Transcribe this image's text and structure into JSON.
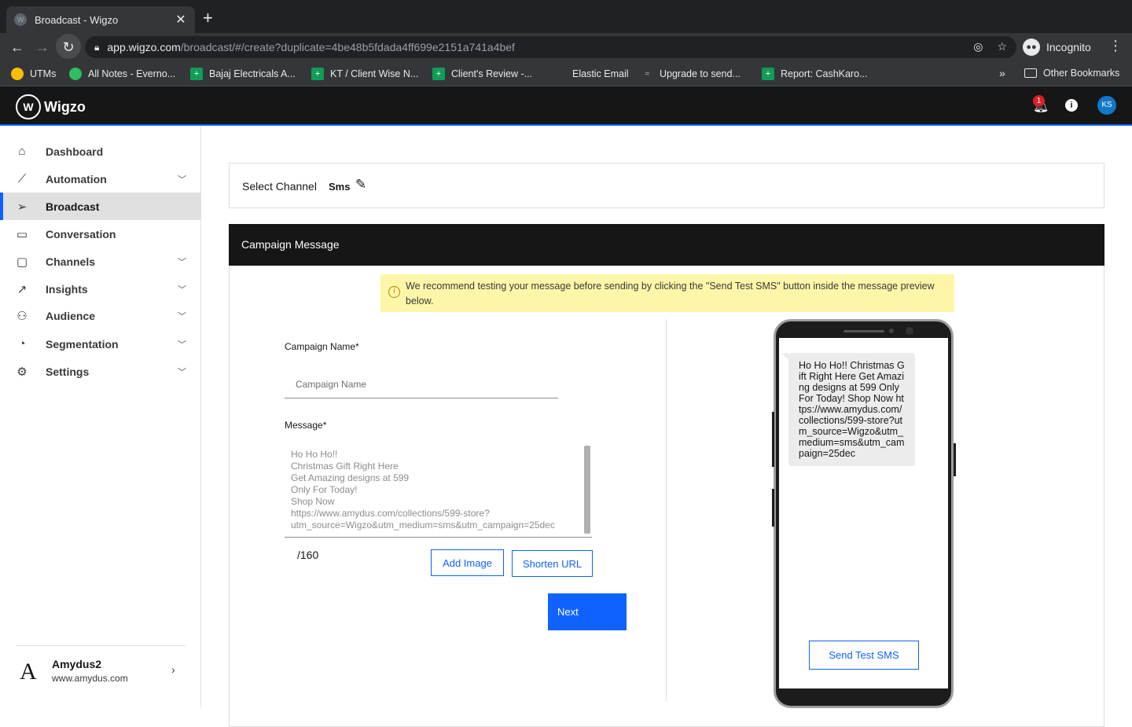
{
  "browser": {
    "tab_title": "Broadcast - Wigzo",
    "tab_favicon": "W",
    "url_host": "app.wigzo.com",
    "url_path": "/broadcast/#/create?duplicate=4be48b5fdada4ff699e2151a741a4bef",
    "profile_label": "Incognito",
    "bookmarks": [
      {
        "label": "UTMs",
        "icon": "chrome-icon",
        "color": "#fbbc04"
      },
      {
        "label": "All Notes - Everno...",
        "icon": "evernote-icon",
        "color": "#2dbe60"
      },
      {
        "label": "Bajaj Electricals A...",
        "icon": "sheets-icon",
        "color": "#0f9d58"
      },
      {
        "label": "KT / Client Wise N...",
        "icon": "sheets-icon",
        "color": "#0f9d58"
      },
      {
        "label": "Client's Review -...",
        "icon": "sheets-icon",
        "color": "#0f9d58"
      },
      {
        "label": "Elastic Email",
        "icon": "elastic-icon",
        "color": "#35363a"
      },
      {
        "label": "Upgrade to send...",
        "icon": "wigzo-icon",
        "color": "#35363a"
      },
      {
        "label": "Report: CashKaro...",
        "icon": "sheets-icon",
        "color": "#0f9d58"
      }
    ],
    "bookmarks_more": "»",
    "other_bookmarks": "Other Bookmarks"
  },
  "header": {
    "logo_mark": "W",
    "logo_text": "Wigzo",
    "notification_count": "1",
    "avatar_initials": "KS"
  },
  "sidebar": {
    "items": [
      {
        "label": "Dashboard",
        "icon": "home-icon",
        "has_chevron": false,
        "active": false
      },
      {
        "label": "Automation",
        "icon": "wand-icon",
        "has_chevron": true,
        "active": false
      },
      {
        "label": "Broadcast",
        "icon": "send-icon",
        "has_chevron": false,
        "active": true
      },
      {
        "label": "Conversation",
        "icon": "chat-icon",
        "has_chevron": false,
        "active": false
      },
      {
        "label": "Channels",
        "icon": "channels-icon",
        "has_chevron": true,
        "active": false
      },
      {
        "label": "Insights",
        "icon": "chart-icon",
        "has_chevron": true,
        "active": false
      },
      {
        "label": "Audience",
        "icon": "users-icon",
        "has_chevron": true,
        "active": false
      },
      {
        "label": "Segmentation",
        "icon": "pie-icon",
        "has_chevron": true,
        "active": false
      },
      {
        "label": "Settings",
        "icon": "gear-icon",
        "has_chevron": true,
        "active": false
      }
    ],
    "account": {
      "logo": "A",
      "name": "Amydus2",
      "url": "www.amydus.com"
    }
  },
  "channel": {
    "label": "Select Channel",
    "value": "Sms"
  },
  "campaign": {
    "panel_title": "Campaign Message",
    "notice": "We recommend testing your message before sending by clicking the \"Send Test SMS\" button inside the message preview below.",
    "name_label": "Campaign Name*",
    "name_placeholder": "Campaign Name",
    "name_value": "",
    "message_label": "Message*",
    "message_lines": [
      "Ho Ho Ho!!",
      "Christmas Gift Right Here",
      "Get Amazing designs at 599",
      "Only For Today!",
      "Shop Now",
      "https://www.amydus.com/collections/599-store?",
      "utm_source=Wigzo&utm_medium=sms&utm_campaign=25dec"
    ],
    "char_counter": "/160",
    "add_image_label": "Add Image",
    "shorten_url_label": "Shorten URL",
    "next_label": "Next"
  },
  "preview": {
    "bubble_text": "Ho Ho Ho!! Christmas Gift Right Here Get Amazing designs at 599 Only For Today! Shop Now https://www.amydus.com/collections/599-store?utm_source=Wigzo&utm_medium=sms&utm_campaign=25dec",
    "send_test_label": "Send Test SMS"
  },
  "colors": {
    "primary": "#0f62fe",
    "header_bg": "#161616",
    "notice_bg": "#fdf6a8",
    "badge": "#da1e28"
  }
}
